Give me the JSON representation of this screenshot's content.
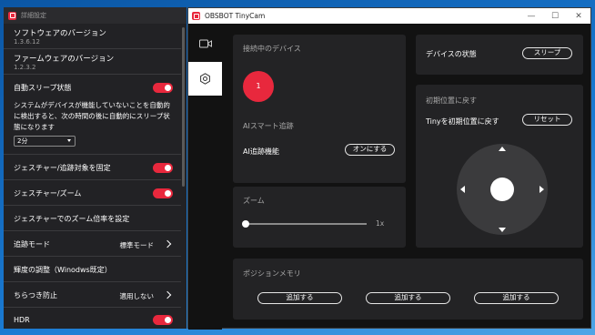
{
  "left_window": {
    "title": "詳細設定",
    "software_version_label": "ソフトウェアのバージョン",
    "software_version": "1.3.6.12",
    "firmware_version_label": "ファームウェアのバージョン",
    "firmware_version": "1.2.3.2",
    "auto_sleep_label": "自動スリープ状態",
    "auto_sleep_desc": "システムがデバイスが機能していないことを自動的に検出すると、次の時間の後に自動的にスリープ状態になります",
    "sleep_time": "2分",
    "gesture_lock_label": "ジェスチャー/追跡対象を固定",
    "gesture_zoom_label": "ジェスチャー/ズーム",
    "gesture_zoom_rate_label": "ジェスチャーでのズーム倍率を設定",
    "tracking_mode_label": "追跡モード",
    "tracking_mode_value": "標準モード",
    "brightness_label": "輝度の調整（Winodws既定）",
    "flicker_label": "ちらつき防止",
    "flicker_value": "適用しない",
    "hdr_label": "HDR"
  },
  "right_window": {
    "title": "OBSBOT TinyCam",
    "connected_device_title": "接続中のデバイス",
    "device_number": "1",
    "ai_tracking_title": "AIスマート追跡",
    "ai_tracking_label": "AI追跡機能",
    "ai_tracking_button": "オンにする",
    "zoom_title": "ズーム",
    "zoom_value": "1x",
    "device_status_label": "デバイスの状態",
    "sleep_button": "スリープ",
    "reset_title": "初期位置に戻す",
    "reset_label": "Tinyを初期位置に戻す",
    "reset_button": "リセット",
    "position_memory_title": "ポジションメモリ",
    "add_buttons": [
      "追加する",
      "追加する",
      "追加する"
    ]
  },
  "zoom_level": 0,
  "colors": {
    "accent": "#e8283d",
    "panel": "#232325",
    "background": "#121212"
  },
  "icons": {
    "camera_tab": "camera-icon",
    "settings_tab": "gear-icon"
  }
}
